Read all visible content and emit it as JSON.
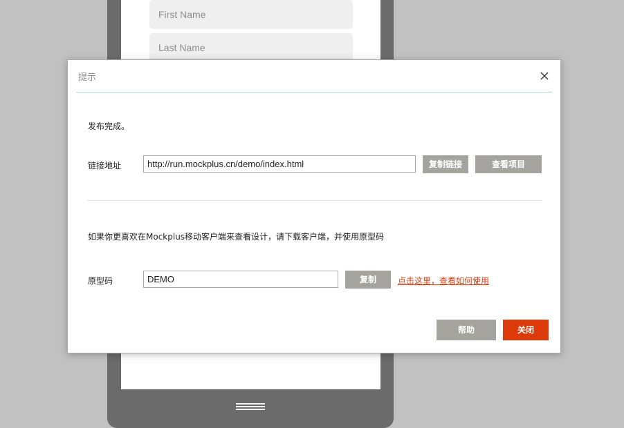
{
  "background": {
    "first_name_placeholder": "First Name",
    "last_name_placeholder": "Last Name"
  },
  "dialog": {
    "title": "提示",
    "close_icon": "close-icon",
    "publish_done": "发布完成。",
    "link_label": "链接地址",
    "link_url": "http://run.mockplus.cn/demo/index.html",
    "copy_link_label": "复制链接",
    "view_project_label": "查看项目",
    "app_prompt": "如果你更喜欢在Mockplus移动客户端来查看设计，请下载客户端，并使用原型码",
    "code_label": "原型码",
    "code_value": "DEMO",
    "copy_label": "复制",
    "howto_link": "点击这里，查看如何使用",
    "help_label": "帮助",
    "close_label": "关闭"
  },
  "colors": {
    "accent_red": "#dd3a0b",
    "button_gray": "#a4a39d",
    "title_rule": "#a6e3c9",
    "overlay_bg": "#c1c1c1"
  }
}
